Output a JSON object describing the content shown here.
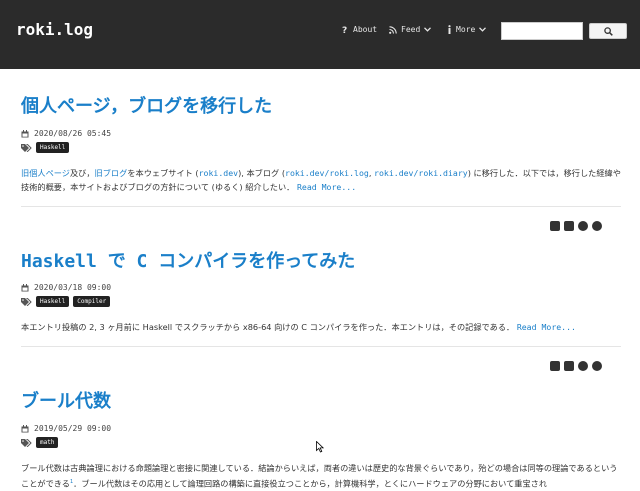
{
  "nav": {
    "brand": "roki.log",
    "about": "About",
    "feed": "Feed",
    "more": "More",
    "search_placeholder": "",
    "search_value": ""
  },
  "posts": [
    {
      "title": "個人ページ，ブログを移行した",
      "date": "2020/08/26 05:45",
      "tags": [
        "Haskell"
      ],
      "excerpt": {
        "link1": "旧個人ページ",
        "t1": "及び，",
        "link2": "旧ブログ",
        "t2": "を本ウェブサイト (",
        "link3": "roki.dev",
        "t3": "), 本ブログ (",
        "link4": "roki.dev/roki.log",
        "t4": ", ",
        "link5": "roki.dev/roki.diary",
        "t5": ") に移行した．以下では，移行した経緯や技術的概要，本サイトおよびブログの方針について (ゆるく) 紹介したい．",
        "read_more": "Read More..."
      }
    },
    {
      "title": "Haskell で C コンパイラを作ってみた",
      "date": "2020/03/18 09:00",
      "tags": [
        "Haskell",
        "Compiler"
      ],
      "excerpt": {
        "t1": "本エントリ投稿の 2, 3 ヶ月前に Haskell でスクラッチから x86-64 向けの C コンパイラを作った．本エントリは，その記録である．",
        "read_more": "Read More..."
      }
    },
    {
      "title": "ブール代数",
      "date": "2019/05/29 09:00",
      "tags": [
        "math"
      ],
      "excerpt": {
        "t1": "ブール代数は古典論理における命題論理と密接に関連している．結論からいえば，両者の違いは歴史的な背景ぐらいであり，殆どの場合は同等の理論であるということができる",
        "sup": "1",
        "t2": "．ブール代数はその応用として論理回路の構築に直接役立つことから，計算機科学，とくにハードウェアの分野において重宝され"
      }
    }
  ],
  "icons": {
    "about": "question-icon",
    "feed": "rss-icon",
    "more": "info-icon",
    "search": "search-icon",
    "calendar": "calendar-icon",
    "tags": "tags-icon",
    "share": [
      "twitter-icon",
      "facebook-icon",
      "line-icon",
      "pocket-icon"
    ]
  },
  "colors": {
    "navbar": "#2b2b2b",
    "link": "#1a7fc9",
    "tag_bg": "#222222"
  }
}
